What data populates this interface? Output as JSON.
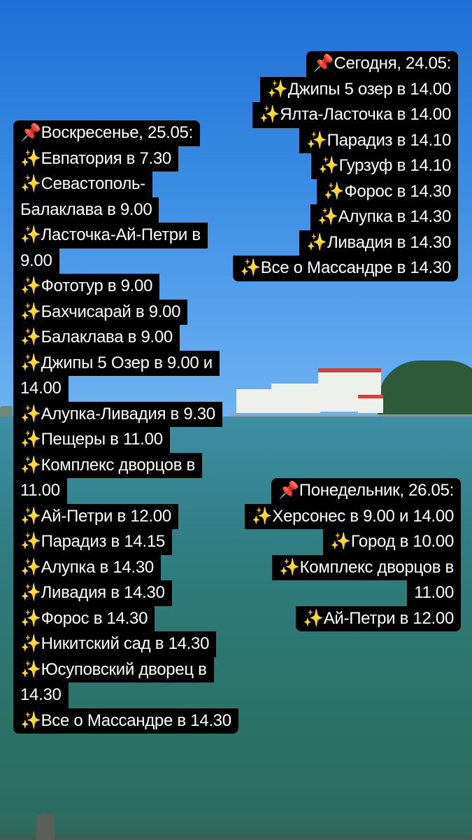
{
  "sections": [
    {
      "id": "today",
      "lines": [
        "📌Сегодня, 24.05:",
        "✨Джипы 5 озер в 14.00",
        "✨Ялта-Ласточка в 14.00",
        "✨Парадиз в 14.10",
        "✨Гурзуф в 14.10",
        "✨Форос в 14.30",
        "✨Алупка в 14.30",
        "✨Ливадия в 14.30",
        "✨Все о Массандре в 14.30"
      ]
    },
    {
      "id": "sunday",
      "lines": [
        "📌Воскресенье, 25.05:",
        "✨Евпатория в 7.30",
        "✨Севастополь-",
        "Балаклава в 9.00",
        "✨Ласточка-Ай-Петри в",
        "9.00",
        "✨Фототур в 9.00",
        "✨Бахчисарай в 9.00",
        "✨Балаклава в 9.00",
        "✨Джипы 5 Озер в 9.00 и",
        "14.00",
        "✨Алупка-Ливадия в 9.30",
        "✨Пещеры в 11.00",
        "✨Комплекс дворцов в",
        "11.00",
        "✨Ай-Петри в 12.00",
        "✨Парадиз в 14.15",
        "✨Алупка в 14.30",
        "✨Ливадия в 14.30",
        "✨Форос в 14.30",
        "✨Никитский сад в 14.30",
        "✨Юсуповский дворец в",
        "14.30",
        "✨Все о Массандре в 14.30"
      ]
    },
    {
      "id": "monday",
      "lines": [
        "📌Понедельник, 26.05:",
        "✨Херсонес в 9.00 и 14.00",
        "✨Город в 10.00",
        "✨Комплекс дворцов в",
        "11.00",
        "✨Ай-Петри в 12.00"
      ]
    }
  ]
}
